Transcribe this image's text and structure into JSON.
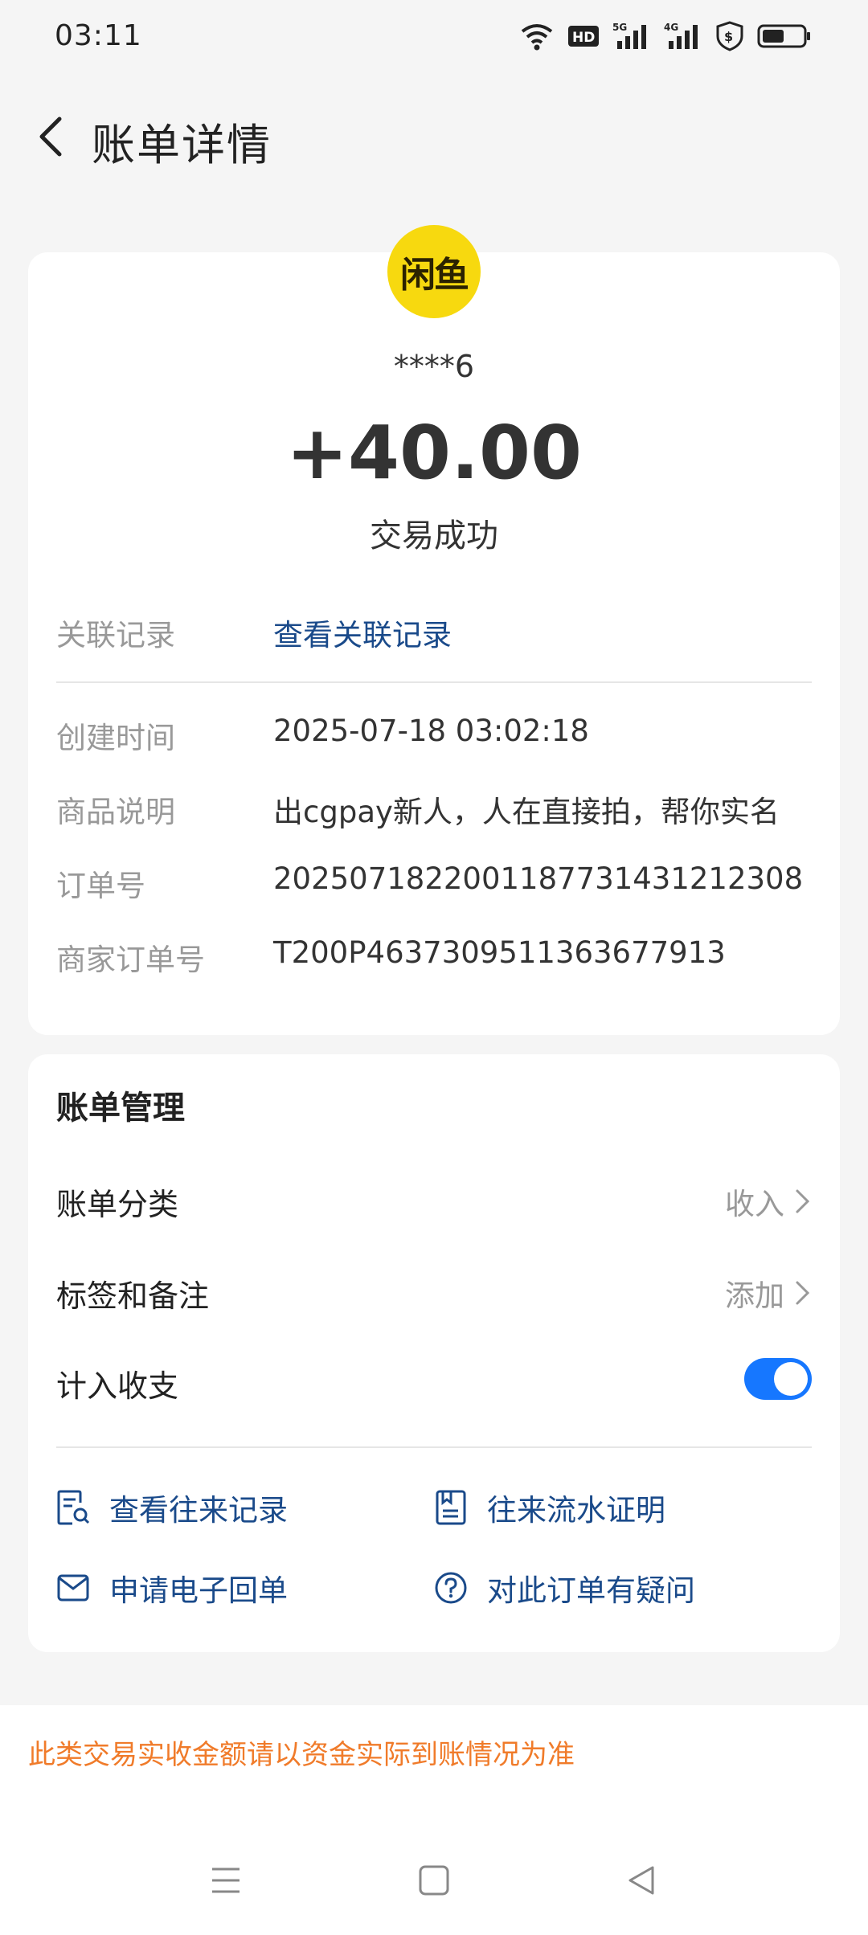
{
  "status_bar": {
    "time": "03:11",
    "icons": [
      "wifi-icon",
      "hd-icon",
      "signal-5g-icon",
      "signal-4g-icon",
      "shield-dollar-icon",
      "battery-icon"
    ]
  },
  "nav": {
    "title": "账单详情"
  },
  "transaction": {
    "merchant_logo_text": "闲鱼",
    "account": "****6",
    "amount": "+40.00",
    "status": "交易成功",
    "related_label": "关联记录",
    "related_link": "查看关联记录",
    "details": [
      {
        "label": "创建时间",
        "value": "2025-07-18 03:02:18"
      },
      {
        "label": "商品说明",
        "value": "出cgpay新人，人在直接拍，帮你实名"
      },
      {
        "label": "订单号",
        "value": "2025071822001187731431212308"
      },
      {
        "label": "商家订单号",
        "value": "T200P4637309511363677913"
      }
    ]
  },
  "manage": {
    "title": "账单管理",
    "category_label": "账单分类",
    "category_value": "收入",
    "tags_label": "标签和备注",
    "tags_value": "添加",
    "include_label": "计入收支",
    "include_on": true,
    "actions": [
      {
        "label": "查看往来记录",
        "icon": "record-search-icon"
      },
      {
        "label": "往来流水证明",
        "icon": "document-icon"
      },
      {
        "label": "申请电子回单",
        "icon": "mail-icon"
      },
      {
        "label": "对此订单有疑问",
        "icon": "question-icon"
      }
    ]
  },
  "notice": "此类交易实收金额请以资金实际到账情况为准",
  "colors": {
    "link": "#1a4a8a",
    "toggle": "#1677ff",
    "notice": "#f07b2a",
    "logo": "#f7d90f"
  }
}
